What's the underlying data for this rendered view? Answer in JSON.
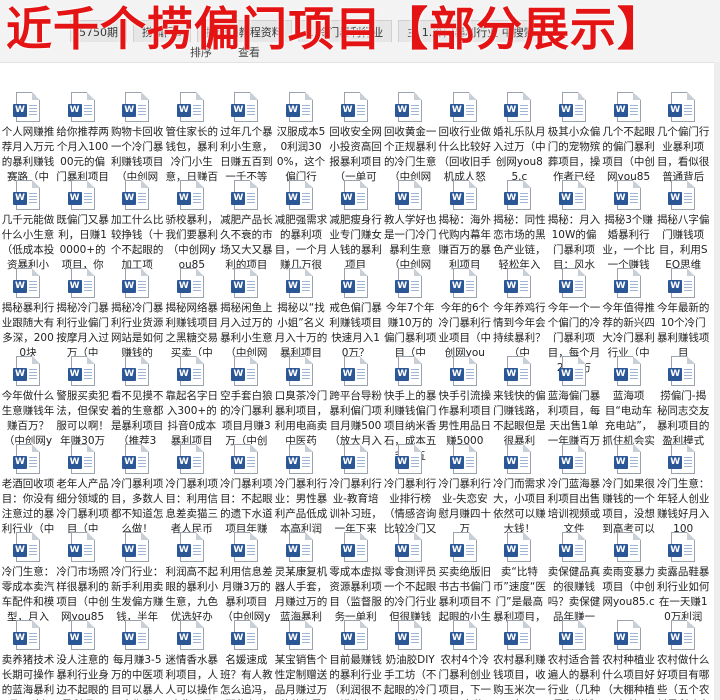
{
  "banner": "近千个捞偏门项目【部分展示】",
  "tabs": [
    "5750期",
    "捞偏门a",
    "捞偏门教程资料",
    "1.冷门暴利行业",
    "主 1.冷门暴利行业 中搜索"
  ],
  "toolbar": [
    "排序",
    "查看"
  ],
  "files": [
    [
      "个人网赚推荐月入万元的暴利赚钱赛路（中",
      "给你推荐两个月入10000元的偏门暴利项目",
      "购物卡回收一个冷门暴利赚钱项目（中创网",
      "管住家长的钱包，暴利冷门小生意，日赚百元",
      "过年几个暴利小生意，日赚五百到一千不等",
      "汉服成本50利润300%，这个偏门行",
      "回收安全网小投资高回报暴利项目（一单可",
      "回收黄金一个正规暴利的冷门生意（中创网",
      "回收行业做什么比较好（回收旧手机成人怒",
      "婚礼乐队月入过万（中创网you85.c",
      "极其小众偏门的宠物殡葬项目，操作者已经",
      "几个不起眼的偏门暴利项目（中创网you85",
      "几个偏门行业暴利项目，看似很普通背后"
    ],
    [
      "几千元能做什么小生意（低成本投资暴利小",
      "既偏门又暴利，日赚10000+的项目，你",
      "加工什么比较挣钱（十个不起眼的加工项",
      "骄校暴利，我们要暴利（中创网you85",
      "减肥产品长久不衰的市场又大又暴利的项目",
      "减肥强需求的暴利项目，一个月赚几万很",
      "减肥瘦身行业专门赚女人钱的暴利项目",
      "教人学好也是一门冷门暴利生意（中创网",
      "揭秘：海外代购内幕年赚百万的暴利项目",
      "揭秘：同性恋市场的黑色产业链，轻松年入",
      "揭秘：月入10W的偏门暴利项目：风水",
      "揭秘3个赚婚暴利行业，一个比一个赚钱",
      "揭秘八字偏门赚钱项目，利用SEO思维"
    ],
    [
      "揭秘暴利行业跟随大有多深，2000块",
      "揭秘冷门暴利行业偏门按摩月入过万（中",
      "揭秘冷门暴利行业货源网站是如何赚钱的",
      "揭秘网络暴利赚钱项目之黑糖交易买卖（中",
      "揭秘闲鱼上月入过万的暴利小生意（中创网",
      "揭秘以“找小姐”名义月入十万的暴利项目",
      "戒色偏门暴利赚钱项目快速月入10万？",
      "今年7个年赚10万的偏门暴利项目（中",
      "今年的6个冷门暴利行业项目（中创网you",
      "今年养鸡行情到今年会持续暴利？（中",
      "今年一个一个偏门的冷门暴利项目，每个月2到5万",
      "今年值得推荐的新兴四大冷门暴利行业（中",
      "今年最新的10个冷门暴利赚钱项目"
    ],
    [
      "今年做什么生意赚钱年赚百万？（中创网you",
      "警服买卖犯法，但保安服可以啊！年赚30万",
      "看不见摸不着的生意都是暴利项目（推荐3",
      "靠起名字日入300+的抖音0成本暴利项目",
      "空手套白狼的冷门暴利项目月赚3万（中创",
      "口臭茶冷门暴利项目，利用电商卖中医药",
      "跨平台导粉暴利偏门项目月赚500（放大月入10",
      "快手上的暴利赚钱偏门项目纳米香石，成本五毛卖五",
      "快手引流操作暴利项目男性用品日赚5000",
      "来钱快的偏门赚钱路，不起眼但是很暴利",
      "蓝海偏门暴利项目，每天出售1单一年赚百万",
      "蓝海项目“电动车充电站”，抓住机会实现",
      "捞偏门-揭秘同志交友暴利项目的盈利模式"
    ],
    [
      "老酒回收项目：你没有注意过的暴利行业（中",
      "老年人产品细分领域的冷门暴利项目（中",
      "冷门暴利项目，多数人都不知道怎么做！",
      "冷门暴利项目：利用信息差卖猫三者人民币",
      "冷门暴利项目：不起眼的遗下水道项目年赚",
      "冷门暴利行业：男性暴利产品低成本高利润",
      "冷门暴利行业-教育培训补习班，一年下来",
      "冷门暴利行业排行榜（情感咨询比较冷门又",
      "冷门暴利行业-失恋安慰月赚四十万",
      "冷门而需求大，小项目依然可以赚大钱！",
      "冷门蓝海暴利项目出售培训视频或文件",
      "冷门如果很赚钱的一个项目，没想到高考可以",
      "冷门生意：年轻人创业赚钱好月入100"
    ],
    [
      "冷门生意：零成本卖汽车配件和模型，月入",
      "冷门市场照样很暴利的项目（中创网you85",
      "冷门行业：新手利用卖生发偏方赚钱，半年",
      "利润高不起眼的暴利小生意，九色优选好办",
      "利用信息差月赚3万的暴利项目（中创网you",
      "灵某康复机器人手套，月赚过万的蓝海暴利",
      "零成本虚拟资源暴利项目（监督服务一单利",
      "零食测评员一个不起眼的冷门行业但很赚钱",
      "买卖绝版旧书古书偏门暴利项目不起眼的小生意",
      "卖“比特币”速度“医门”是最高暴利项目，年",
      "卖保健品真的很赚钱吗？卖保健品年赚一",
      "卖雨变暴力项目（中创网you85.c",
      "卖露品鞋暴利行业如何在一天赚10万利润"
    ],
    [
      "卖养猪技术长期可操作的蓝海暴利项目（中",
      "没人注意的暴利行业身边不起眼的暴利项目",
      "每月赚3-5万的中医项目可以暴人合作赚",
      "迷情香水暴利项目，人人可以操作出售，月",
      "名媛速成班？有人教怎么追冯，那些有人",
      "某宝销售个性定制赠送品月赚过万的蓝海暴",
      "目前最赚钱的暴利行业（利润很不错人才",
      "奶油胶DIY手工坊（不起眼的冷门行业",
      "农村4个冷门暴利创业项目，下一个“富翁",
      "农村暴利赚钱项目，收购玉米次一年",
      "农村适合普遍人的暴利行业（几种暴利赚钱",
      "农村种植业什么项目好（大棚种植西红柿不",
      "农村做什么好项目有哪些（五个农村暴利致富"
    ]
  ]
}
